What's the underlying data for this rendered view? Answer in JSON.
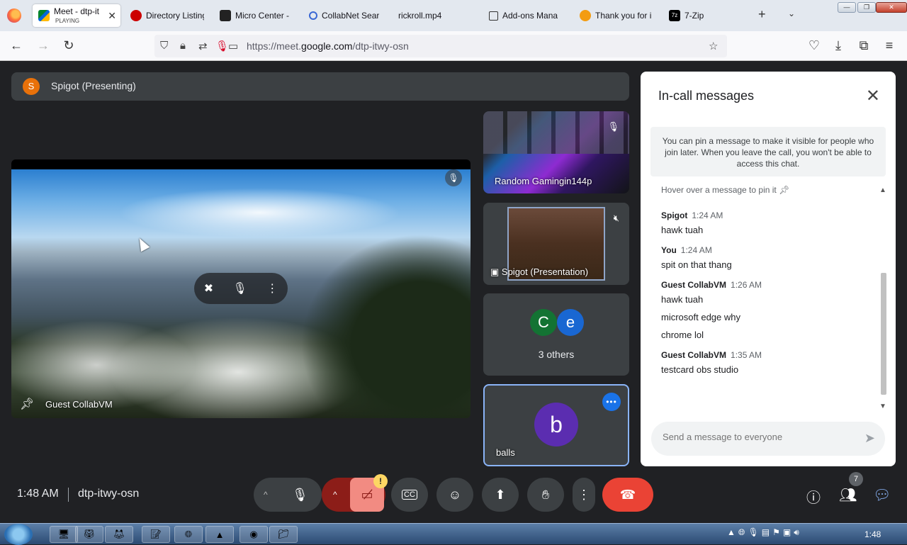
{
  "browser": {
    "tabs": [
      {
        "label": "Meet - dtp-it",
        "sub": "PLAYING",
        "active": true
      },
      {
        "label": "Directory Listing"
      },
      {
        "label": "Micro Center - I"
      },
      {
        "label": "CollabNet Sear"
      },
      {
        "label": "rickroll.mp4"
      },
      {
        "label": "Add-ons Mana"
      },
      {
        "label": "Thank you for i"
      },
      {
        "label": "7-Zip"
      }
    ],
    "url_prefix": "https://meet.",
    "url_domain": "google.com",
    "url_path": "/dtp-itwy-osn"
  },
  "meet": {
    "presenting_avatar": "S",
    "presenting_label": "Spigot (Presenting)",
    "main_tile_name": "Guest CollabVM",
    "tiles": [
      {
        "name": "Random Gamingin144p"
      },
      {
        "name": "Spigot (Presentation)"
      },
      {
        "avatars": [
          "C",
          "e"
        ],
        "label": "3 others"
      },
      {
        "avatar": "b",
        "name": "balls"
      }
    ],
    "time": "1:48 AM",
    "meeting_code": "dtp-itwy-osn",
    "alert_badge": "!",
    "people_count": "7"
  },
  "chat": {
    "title": "In-call messages",
    "notice": "You can pin a message to make it visible for people who join later. When you leave the call, you won't be able to access this chat.",
    "hint": "Hover over a message to pin it",
    "messages": [
      {
        "sender": "Spigot",
        "time": "1:24 AM",
        "lines": [
          "hawk tuah"
        ]
      },
      {
        "sender": "You",
        "time": "1:24 AM",
        "lines": [
          "spit on that thang"
        ]
      },
      {
        "sender": "Guest CollabVM",
        "time": "1:26 AM",
        "lines": [
          "hawk tuah",
          "microsoft edge why",
          "chrome lol"
        ]
      },
      {
        "sender": "Guest CollabVM",
        "time": "1:35 AM",
        "lines": [
          "testcard obs studio"
        ]
      }
    ],
    "composer_placeholder": "Send a message to everyone"
  },
  "taskbar": {
    "clock": "1:48"
  },
  "colors": {
    "meet_bg": "#202124",
    "leave_red": "#ea4335",
    "accent_blue": "#1a73e8"
  }
}
